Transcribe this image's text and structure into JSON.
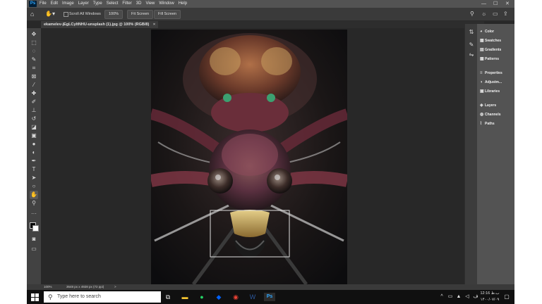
{
  "app": {
    "logo_text": "Ps",
    "menu": [
      "File",
      "Edit",
      "Image",
      "Layer",
      "Type",
      "Select",
      "Filter",
      "3D",
      "View",
      "Window",
      "Help"
    ]
  },
  "options": {
    "scroll_all_label": "Scroll All Windows",
    "zoom_100": "100%",
    "fit_screen": "Fit Screen",
    "fill_screen": "Fill Screen"
  },
  "document": {
    "tab_title": "ekamelev-jEgLCyItNHU-unsplash (1).jpg @ 100% (RGB/8)",
    "close_glyph": "×"
  },
  "panels": [
    {
      "icon": "color-icon",
      "label": "Color"
    },
    {
      "icon": "swatches-icon",
      "label": "Swatches"
    },
    {
      "icon": "gradients-icon",
      "label": "Gradients"
    },
    {
      "icon": "patterns-icon",
      "label": "Patterns"
    },
    {
      "icon": "properties-icon",
      "label": "Properties"
    },
    {
      "icon": "adjustments-icon",
      "label": "Adjustm..."
    },
    {
      "icon": "libraries-icon",
      "label": "Libraries"
    },
    {
      "icon": "layers-icon",
      "label": "Layers"
    },
    {
      "icon": "channels-icon",
      "label": "Channels"
    },
    {
      "icon": "paths-icon",
      "label": "Paths"
    }
  ],
  "status": {
    "zoom": "100%",
    "doc_size": "3648 px x 4928 px (72 ppi)",
    "arrow": ">"
  },
  "taskbar": {
    "search_placeholder": "Type here to search",
    "time": "12:16 ب.ظ",
    "date": "۱۴۰۰/۰۷/۰۹"
  }
}
